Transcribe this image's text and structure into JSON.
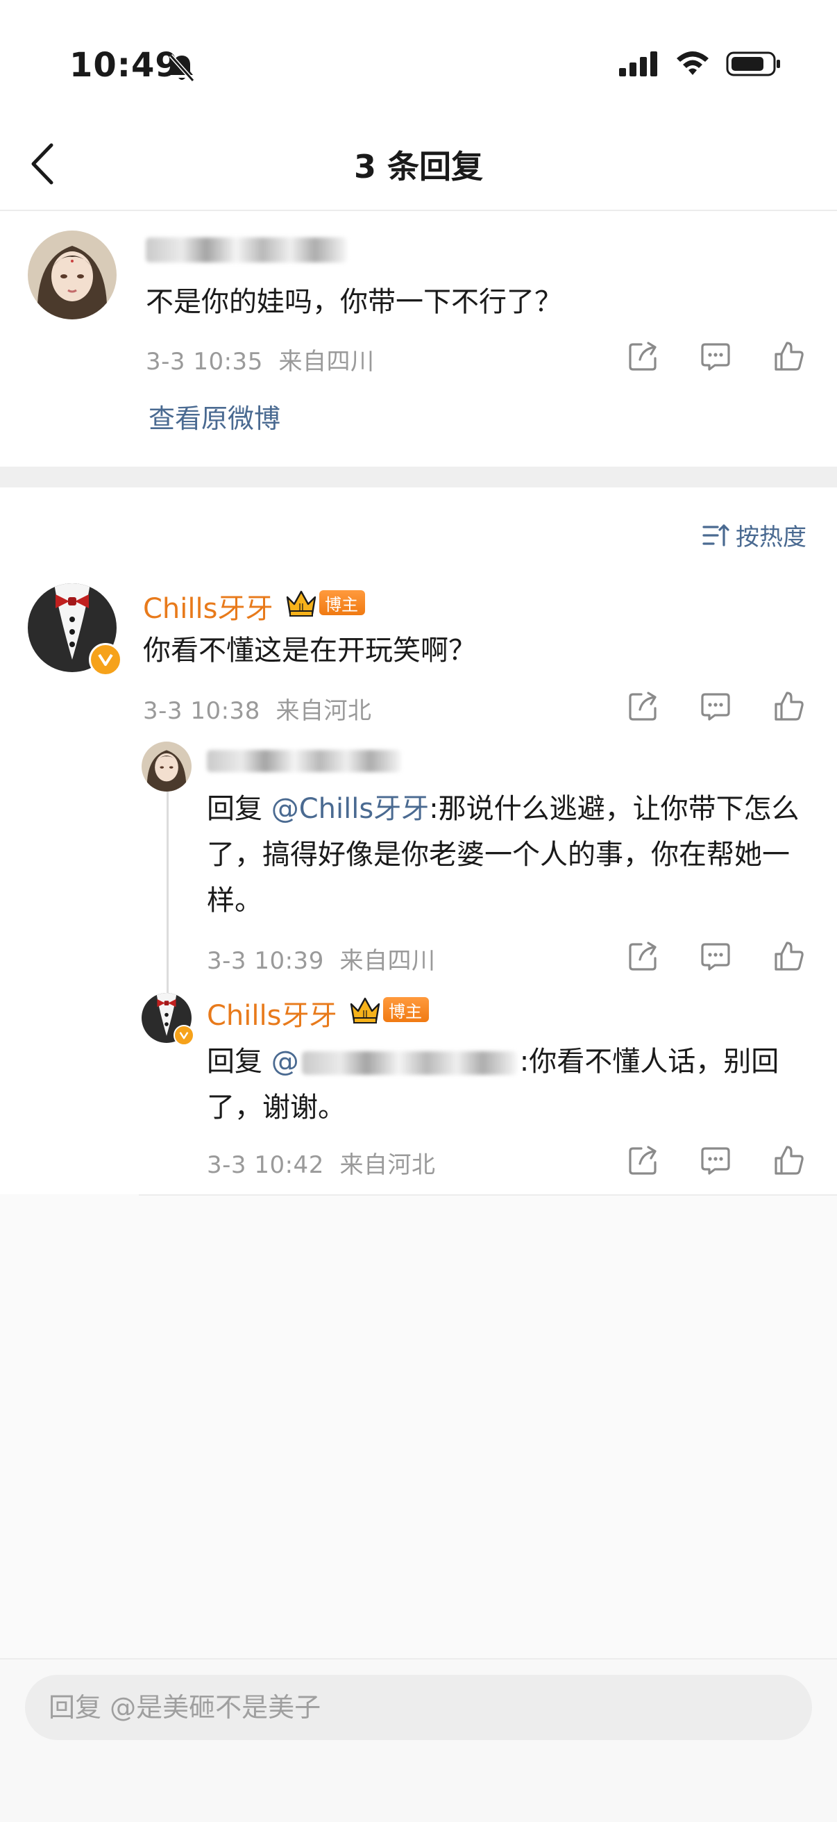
{
  "status_bar": {
    "time": "10:49"
  },
  "nav": {
    "title": "3 条回复"
  },
  "root_comment": {
    "text": "不是你的娃吗，你带一下不行了？",
    "time": "3-3 10:35",
    "location": "来自四川",
    "view_original": "查看原微博"
  },
  "sort": {
    "label": "按热度"
  },
  "replies": [
    {
      "author": "Chills牙牙",
      "badge": "博主",
      "text": "你看不懂这是在开玩笑啊？",
      "time": "3-3 10:38",
      "location": "来自河北"
    }
  ],
  "sub_replies": [
    {
      "prefix": "回复 ",
      "mention": "@Chills牙牙",
      "text": ":那说什么逃避，让你带下怎么了，搞得好像是你老婆一个人的事，你在帮她一样。",
      "time": "3-3 10:39",
      "location": "来自四川"
    },
    {
      "author": "Chills牙牙",
      "badge": "博主",
      "prefix": "回复 ",
      "mention_start": "@",
      "text": ":你看不懂人话，别回了，谢谢。",
      "time": "3-3 10:42",
      "location": "来自河北"
    }
  ],
  "reply_box": {
    "placeholder": "回复 @是美砸不是美子"
  },
  "colors": {
    "accent_orange": "#e87a1b",
    "link_blue": "#4a6a91",
    "meta_gray": "#9a9a9a"
  }
}
